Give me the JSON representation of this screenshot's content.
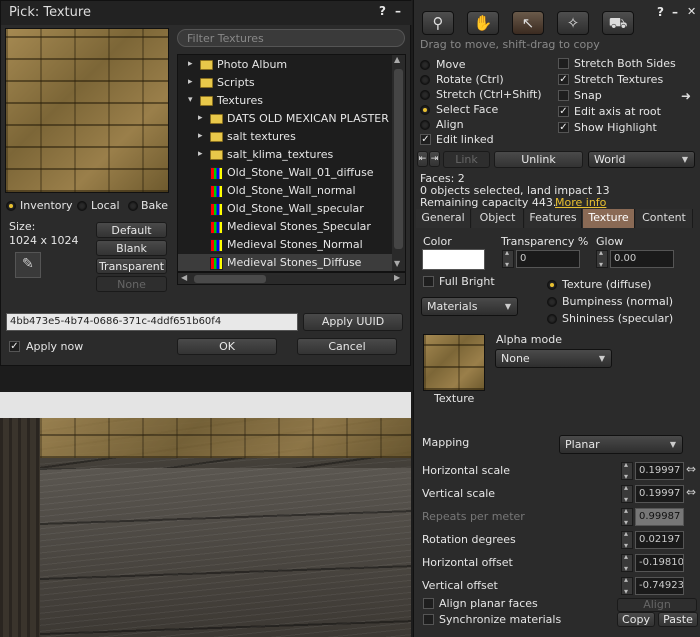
{
  "picker": {
    "title": "Pick: Texture",
    "help": "?",
    "minimize": "–",
    "filter_placeholder": "Filter Textures",
    "tree": [
      {
        "label": "Photo Album",
        "kind": "folder",
        "indent": 0,
        "arrow": "▸"
      },
      {
        "label": "Scripts",
        "kind": "folder",
        "indent": 0,
        "arrow": "▸"
      },
      {
        "label": "Textures",
        "kind": "folder",
        "indent": 0,
        "arrow": "▾"
      },
      {
        "label": "DATS OLD MEXICAN PLASTER WALL",
        "kind": "folder",
        "indent": 1,
        "arrow": "▸"
      },
      {
        "label": "salt textures",
        "kind": "folder",
        "indent": 1,
        "arrow": "▸"
      },
      {
        "label": "salt_klima_textures",
        "kind": "folder",
        "indent": 1,
        "arrow": "▸"
      },
      {
        "label": "Old_Stone_Wall_01_diffuse",
        "kind": "texture",
        "indent": 1,
        "arrow": ""
      },
      {
        "label": "Old_Stone_Wall_normal",
        "kind": "texture",
        "indent": 1,
        "arrow": ""
      },
      {
        "label": "Old_Stone_Wall_specular",
        "kind": "texture",
        "indent": 1,
        "arrow": ""
      },
      {
        "label": "Medieval Stones_Specular",
        "kind": "texture",
        "indent": 1,
        "arrow": ""
      },
      {
        "label": "Medieval Stones_Normal",
        "kind": "texture",
        "indent": 1,
        "arrow": ""
      },
      {
        "label": "Medieval Stones_Diffuse",
        "kind": "texture",
        "indent": 1,
        "arrow": "",
        "selected": true
      }
    ],
    "source_inventory": "Inventory",
    "source_local": "Local",
    "source_bake": "Bake",
    "size_label": "Size:",
    "size_value": "1024 x 1024",
    "default_btn": "Default",
    "blank_btn": "Blank",
    "transparent_btn": "Transparent",
    "none_btn": "None",
    "uuid": "4bb473e5-4b74-0686-371c-4ddf651b60f4",
    "apply_uuid": "Apply UUID",
    "apply_now": "Apply now",
    "ok": "OK",
    "cancel": "Cancel"
  },
  "build": {
    "help": "?",
    "minimize": "–",
    "close": "✕",
    "hint": "Drag to move, shift-drag to copy",
    "tools": [
      "magnify-icon",
      "hand-icon",
      "arrow-icon",
      "wand-icon",
      "bulldozer-icon"
    ],
    "options_left": [
      "Move",
      "Rotate (Ctrl)",
      "Stretch (Ctrl+Shift)",
      "Select Face",
      "Align"
    ],
    "edit_linked": "Edit linked",
    "options_right": [
      {
        "label": "Stretch Both Sides",
        "checked": false
      },
      {
        "label": "Stretch Textures",
        "checked": true
      },
      {
        "label": "Snap",
        "checked": false
      },
      {
        "label": "Edit axis at root",
        "checked": true
      },
      {
        "label": "Show Highlight",
        "checked": true
      }
    ],
    "link": "Link",
    "unlink": "Unlink",
    "world": "World",
    "faces": "Faces: 2",
    "selected": "0 objects selected, land impact 13",
    "remaining": "Remaining capacity 443.",
    "more_info": "More info",
    "tabs": [
      "General",
      "Object",
      "Features",
      "Texture",
      "Content"
    ],
    "active_tab": "Texture",
    "color_label": "Color",
    "transparency_label": "Transparency %",
    "transparency_value": "0",
    "glow_label": "Glow",
    "glow_value": "0.00",
    "full_bright": "Full Bright",
    "materials": "Materials",
    "map_types": [
      "Texture (diffuse)",
      "Bumpiness (normal)",
      "Shininess (specular)"
    ],
    "alpha_mode_label": "Alpha mode",
    "alpha_mode": "None",
    "texture_caption": "Texture",
    "mapping_label": "Mapping",
    "mapping": "Planar",
    "params": [
      {
        "label": "Horizontal scale",
        "value": "0.19997",
        "dim": false
      },
      {
        "label": "Vertical scale",
        "value": "0.19997",
        "dim": false
      },
      {
        "label": "Repeats per meter",
        "value": "0.99987",
        "dim": true
      },
      {
        "label": "Rotation degrees",
        "value": "0.02197",
        "dim": false
      },
      {
        "label": "Horizontal offset",
        "value": "-0.19810",
        "dim": false
      },
      {
        "label": "Vertical offset",
        "value": "-0.74923",
        "dim": false
      }
    ],
    "align_planar": "Align planar faces",
    "align_btn": "Align",
    "sync_materials": "Synchronize materials",
    "copy": "Copy",
    "paste": "Paste"
  }
}
